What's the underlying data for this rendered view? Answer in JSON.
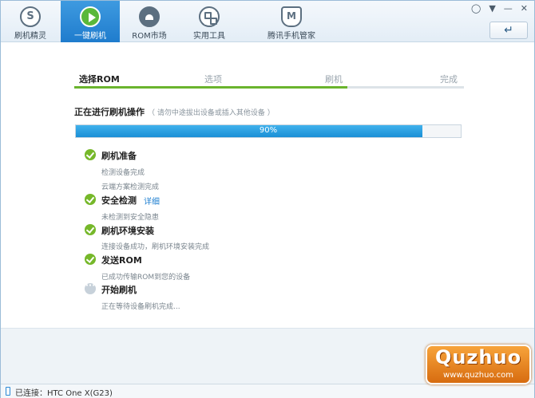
{
  "nav": {
    "items": [
      {
        "label": "刷机精灵",
        "icon": "s-logo-icon"
      },
      {
        "label": "一键刷机",
        "icon": "play-icon",
        "active": true
      },
      {
        "label": "ROM市场",
        "icon": "android-icon"
      },
      {
        "label": "实用工具",
        "icon": "grid-icon"
      },
      {
        "label": "腾讯手机管家",
        "icon": "shield-m-icon"
      }
    ],
    "window_controls": [
      "chat-icon",
      "dropdown-icon",
      "minimize-icon",
      "close-icon"
    ],
    "back_button_icon": "arrow-return-icon",
    "active_color": "#2a86d6"
  },
  "steps": {
    "items": [
      "选择ROM",
      "选项",
      "刷机",
      "完成"
    ],
    "active_index": 0,
    "progress": 0.7,
    "progress_color": "#6ab42d"
  },
  "operation": {
    "title": "正在进行刷机操作",
    "hint": "（ 请勿中途拔出设备或插入其他设备 ）",
    "progress_value": 0.9,
    "progress_text": "90%",
    "bar_color": "#1a8fd6"
  },
  "tasks": [
    {
      "title": "刷机准备",
      "status": "done",
      "details": [
        "检测设备完成",
        "云端方案检测完成"
      ]
    },
    {
      "title": "安全检测",
      "status": "done",
      "link": "详细",
      "details": [
        "未检测到安全隐患"
      ]
    },
    {
      "title": "刷机环境安装",
      "status": "done",
      "details": [
        "连接设备成功，刷机环境安装完成"
      ]
    },
    {
      "title": "发送ROM",
      "status": "done",
      "details": [
        "已成功传输ROM到您的设备"
      ]
    },
    {
      "title": "开始刷机",
      "status": "pending",
      "details": [
        "正在等待设备刷机完成..."
      ]
    }
  ],
  "status_bar": {
    "text": "已连接：HTC One X(G23)"
  },
  "watermark": {
    "brand": "Quzhuo",
    "url": "www.quzhuo.com"
  }
}
